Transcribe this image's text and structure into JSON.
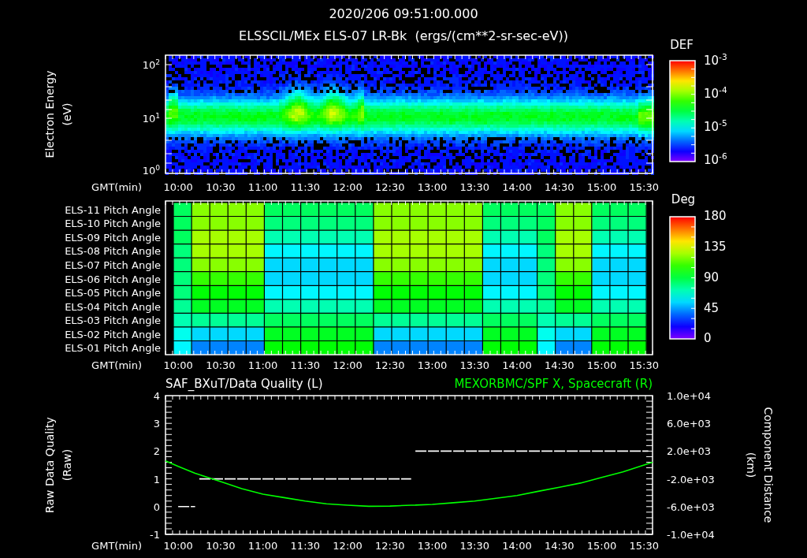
{
  "header": {
    "title": "2020/206 09:51:00.000",
    "subtitle": "ELSSCIL/MEx ELS-07 LR-Bk  (ergs/(cm**2-sr-sec-eV))"
  },
  "energy_panel": {
    "ylabel": [
      "Electron Energy",
      "(eV)"
    ],
    "yticks": [
      "10$^{2}$",
      "10$^{1}$",
      "10$^{0}$"
    ],
    "xlabel": "GMT(min)",
    "xticks": [
      "10:00",
      "10:30",
      "11:00",
      "11:30",
      "12:00",
      "12:30",
      "13:00",
      "13:30",
      "14:00",
      "14:30",
      "15:00",
      "15:30"
    ],
    "colorbar": {
      "label": "DEF",
      "ticks": [
        "10$^{-3}$",
        "10$^{-4}$",
        "10$^{-5}$",
        "10$^{-6}$"
      ]
    }
  },
  "pitch_panel": {
    "row_labels": [
      "ELS-11 Pitch Angle",
      "ELS-10 Pitch Angle",
      "ELS-09 Pitch Angle",
      "ELS-08 Pitch Angle",
      "ELS-07 Pitch Angle",
      "ELS-06 Pitch Angle",
      "ELS-05 Pitch Angle",
      "ELS-04 Pitch Angle",
      "ELS-03 Pitch Angle",
      "ELS-02 Pitch Angle",
      "ELS-01 Pitch Angle"
    ],
    "xlabel": "GMT(min)",
    "xticks": [
      "10:00",
      "10:30",
      "11:00",
      "11:30",
      "12:00",
      "12:30",
      "13:00",
      "13:30",
      "14:00",
      "14:30",
      "15:00",
      "15:30"
    ],
    "colorbar": {
      "label": "Deg",
      "ticks": [
        "180",
        "135",
        "90",
        "45",
        "0"
      ]
    }
  },
  "quality_panel": {
    "ylabel": [
      "Raw Data Quality",
      "(Raw)"
    ],
    "y2label": [
      "Component Distance",
      "(km)"
    ],
    "chart_data": {
      "type": "line",
      "xlabel": "GMT(min)",
      "x": [
        591,
        600,
        612,
        615,
        630,
        645,
        660,
        675,
        690,
        705,
        720,
        735,
        750,
        765,
        768,
        780,
        795,
        810,
        825,
        840,
        855,
        870,
        885,
        900,
        915,
        930,
        933,
        936
      ],
      "xlim": [
        591,
        936
      ],
      "ylim": [
        -1,
        4
      ],
      "yticks": [
        -1,
        0,
        1,
        2,
        3,
        4
      ],
      "y2lim": [
        -10000,
        10000
      ],
      "y2ticks": [
        {
          "value": 10000,
          "label": "1.0e+04"
        },
        {
          "value": 6000,
          "label": "6.0e+03"
        },
        {
          "value": 2000,
          "label": "2.0e+03"
        },
        {
          "value": -2000,
          "label": "-2.0e+03"
        },
        {
          "value": -6000,
          "label": "-6.0e+03"
        },
        {
          "value": -10000,
          "label": "-1.0e+04"
        }
      ],
      "xticks": [
        {
          "value": 600,
          "label": "10:00"
        },
        {
          "value": 630,
          "label": "10:30"
        },
        {
          "value": 660,
          "label": "11:00"
        },
        {
          "value": 690,
          "label": "11:30"
        },
        {
          "value": 720,
          "label": "12:00"
        },
        {
          "value": 750,
          "label": "12:30"
        },
        {
          "value": 780,
          "label": "13:00"
        },
        {
          "value": 810,
          "label": "13:30"
        },
        {
          "value": 840,
          "label": "14:00"
        },
        {
          "value": 870,
          "label": "14:30"
        },
        {
          "value": 900,
          "label": "15:00"
        },
        {
          "value": 930,
          "label": "15:30"
        }
      ],
      "series": [
        {
          "name": "SAF_BXuT/Data Quality (L)",
          "color": "#ffffff",
          "line_style": "dashed",
          "values": [
            null,
            0,
            0,
            1,
            1,
            1,
            1,
            1,
            1,
            1,
            1,
            1,
            1,
            1,
            2,
            2,
            2,
            2,
            2,
            2,
            2,
            2,
            2,
            2,
            2,
            2,
            2,
            null
          ]
        },
        {
          "name": "MEXORBMC/SPF X, Spacecraft (R)",
          "color": "#00ff00",
          "line_style": "solid",
          "axis": "y2",
          "values": [
            600,
            -200,
            -1200,
            -1400,
            -2400,
            -3400,
            -4200,
            -4700,
            -5200,
            -5600,
            -5800,
            -5960,
            -5920,
            -5800,
            -5780,
            -5680,
            -5440,
            -5200,
            -4800,
            -4400,
            -3800,
            -3200,
            -2600,
            -1800,
            -1000,
            0,
            200,
            400
          ]
        }
      ]
    }
  }
}
